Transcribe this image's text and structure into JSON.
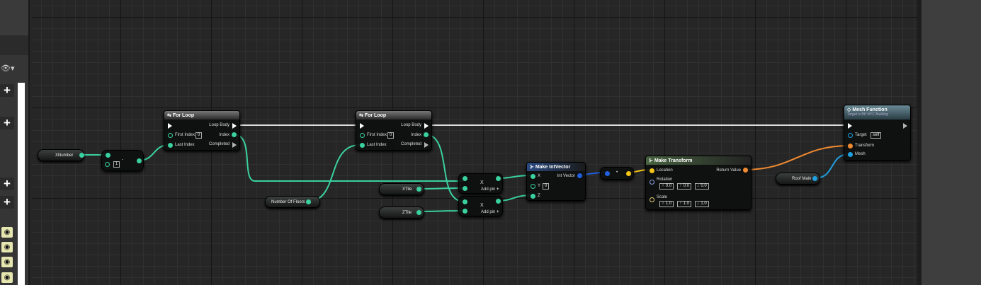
{
  "left_panel": {
    "eye_icon": "eye-icon",
    "visibility_dropdown": "▾",
    "add_buttons": [
      "+",
      "+",
      "+",
      "+"
    ],
    "eye_toggles": 4
  },
  "nodes": {
    "xnumber": {
      "label": "XNumber"
    },
    "subtract": {
      "op": "-",
      "value": "1"
    },
    "for_loop_1": {
      "title": "For Loop",
      "loop_body": "Loop Body",
      "first_index": "First Index",
      "first_index_value": "0",
      "index": "Index",
      "last_index": "Last Index",
      "completed": "Completed"
    },
    "for_loop_2": {
      "title": "For Loop",
      "loop_body": "Loop Body",
      "first_index": "First Index",
      "first_index_value": "0",
      "index": "Index",
      "last_index": "Last Index",
      "completed": "Completed"
    },
    "number_of_floors": {
      "label": "Number Of Floors"
    },
    "xtile": {
      "label": "XTile"
    },
    "ztile": {
      "label": "ZTile"
    },
    "multiply_1": {
      "op": "X",
      "add_pin": "Add pin"
    },
    "multiply_2": {
      "op": "X",
      "add_pin": "Add pin"
    },
    "make_int_vector": {
      "title": "Make IntVector",
      "x": "X",
      "y": "Y",
      "y_value": "0",
      "z": "Z",
      "out": "Int Vector"
    },
    "conversion": {
      "label": "•"
    },
    "make_transform": {
      "title": "Make Transform",
      "location": "Location",
      "rotation": "Rotation",
      "rot": [
        "0.0",
        "0.0",
        "0.0"
      ],
      "scale": "Scale",
      "scl": [
        "1.0",
        "1.0",
        "1.0"
      ],
      "return_value": "Return Value",
      "axes": [
        "X",
        "Y",
        "Z"
      ]
    },
    "roof_main": {
      "label": "Roof Main"
    },
    "mesh_function": {
      "title": "Mesh Function",
      "subtitle": "Target is BP NYC Building",
      "target": "Target",
      "target_value": "self",
      "transform": "Transform",
      "mesh": "Mesh"
    }
  },
  "colors": {
    "int": "#3ad0a0",
    "exec": "#ffffff",
    "vector": "#f5c518",
    "transform": "#f08a30",
    "object": "#1fa0e0",
    "intvector": "#2060e0"
  }
}
